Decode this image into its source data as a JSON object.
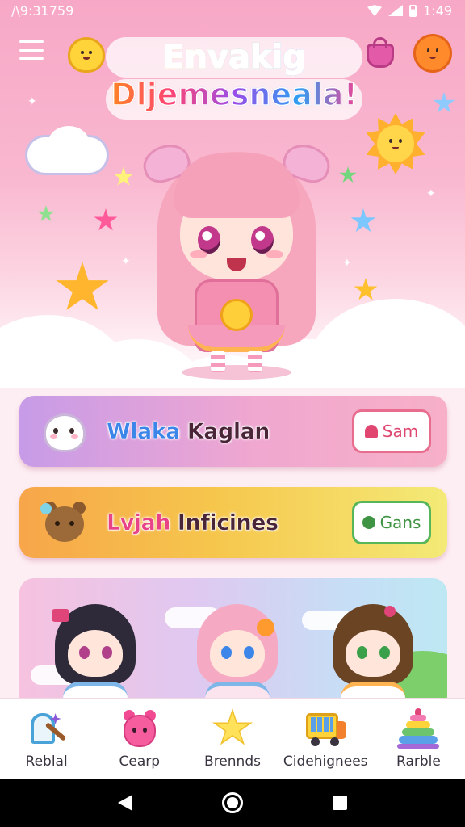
{
  "status_bar": {
    "left_text": "/\\9:31759",
    "time": "1:49"
  },
  "header": {
    "title_line1": "Envakig",
    "title_line2": "Dljemesneala!"
  },
  "cards": [
    {
      "title_part1": "Wlaka",
      "title_part2": "Kaglan",
      "button_label": "Sam",
      "accent": "#e86c8e"
    },
    {
      "title_part1": "Lvjah",
      "title_part2": "Inficines",
      "button_label": "Gans",
      "accent": "#57b65a"
    }
  ],
  "bottom_nav": {
    "items": [
      {
        "label": "Reblal",
        "icon": "magic-wand-icon"
      },
      {
        "label": "Cearp",
        "icon": "bear-icon"
      },
      {
        "label": "Brennds",
        "icon": "star-icon"
      },
      {
        "label": "Cidehignees",
        "icon": "truck-icon"
      },
      {
        "label": "Rarble",
        "icon": "stacking-rings-icon"
      }
    ]
  },
  "colors": {
    "hero_pink": "#f7a8c6",
    "card_pink": "#f0a7d0",
    "card_yellow": "#f6c64c"
  }
}
